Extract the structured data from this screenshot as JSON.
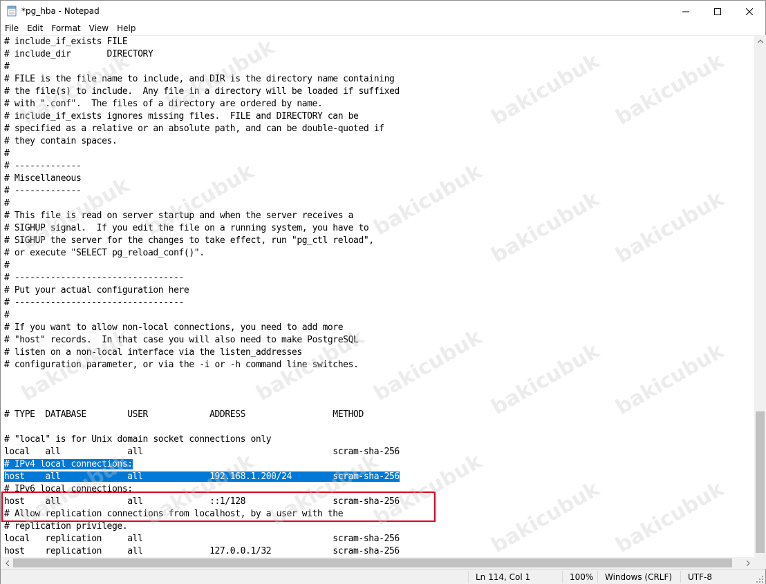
{
  "window": {
    "title": "*pg_hba - Notepad"
  },
  "menu": {
    "items": [
      "File",
      "Edit",
      "Format",
      "View",
      "Help"
    ]
  },
  "editor": {
    "lines": [
      "# include_if_exists FILE",
      "# include_dir       DIRECTORY",
      "#",
      "# FILE is the file name to include, and DIR is the directory name containing",
      "# the file(s) to include.  Any file in a directory will be loaded if suffixed",
      "# with \".conf\".  The files of a directory are ordered by name.",
      "# include_if_exists ignores missing files.  FILE and DIRECTORY can be",
      "# specified as a relative or an absolute path, and can be double-quoted if",
      "# they contain spaces.",
      "#",
      "# -------------",
      "# Miscellaneous",
      "# -------------",
      "#",
      "# This file is read on server startup and when the server receives a",
      "# SIGHUP signal.  If you edit the file on a running system, you have to",
      "# SIGHUP the server for the changes to take effect, run \"pg_ctl reload\",",
      "# or execute \"SELECT pg_reload_conf()\".",
      "#",
      "# ---------------------------------",
      "# Put your actual configuration here",
      "# ---------------------------------",
      "#",
      "# If you want to allow non-local connections, you need to add more",
      "# \"host\" records.  In that case you will also need to make PostgreSQL",
      "# listen on a non-local interface via the listen_addresses",
      "# configuration parameter, or via the -i or -h command line switches.",
      "",
      "",
      "",
      "# TYPE  DATABASE        USER            ADDRESS                 METHOD",
      "",
      "# \"local\" is for Unix domain socket connections only",
      "local   all             all                                     scram-sha-256",
      "# IPv4 local connections:",
      "host    all             all             192.168.1.200/24        scram-sha-256",
      "# IPv6 local connections:",
      "host    all             all             ::1/128                 scram-sha-256",
      "# Allow replication connections from localhost, by a user with the",
      "# replication privilege.",
      "local   replication     all                                     scram-sha-256",
      "host    replication     all             127.0.0.1/32            scram-sha-256"
    ],
    "selected_lines": [
      34,
      35
    ]
  },
  "status": {
    "position": "Ln 114, Col 1",
    "zoom": "100%",
    "line_ending": "Windows (CRLF)",
    "encoding": "UTF-8"
  },
  "watermark": "bakicubuk",
  "colors": {
    "selection": "#0078d7",
    "highlight_border": "#e0001b"
  }
}
